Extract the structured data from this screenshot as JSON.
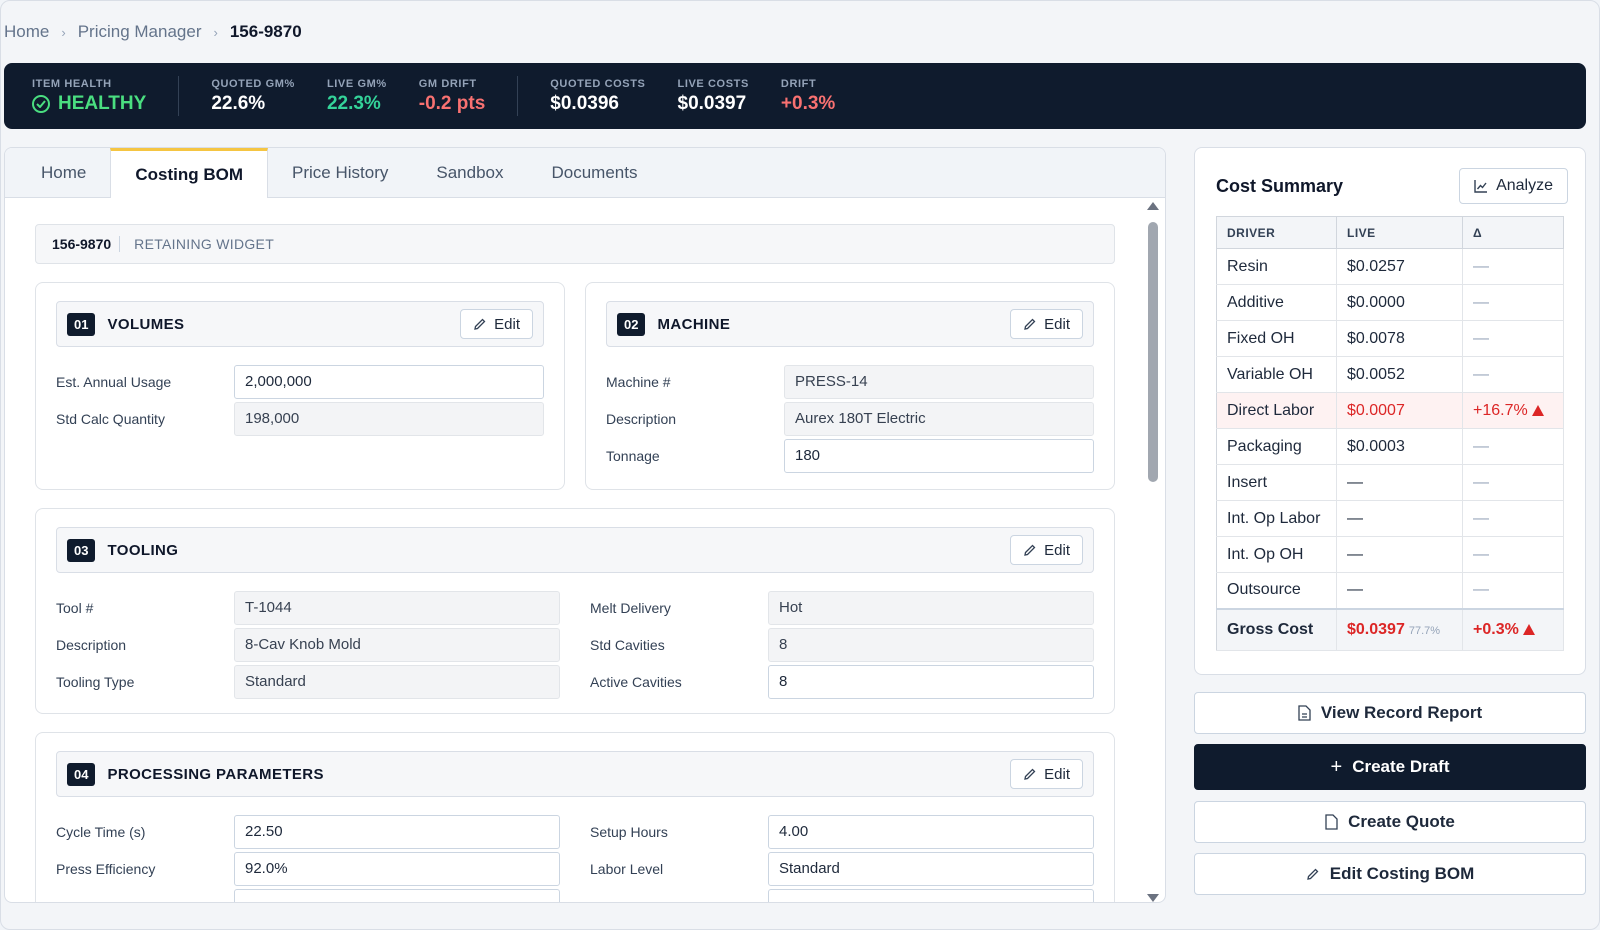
{
  "breadcrumb": {
    "home": "Home",
    "section": "Pricing Manager",
    "current": "156-9870"
  },
  "health": {
    "item_health_label": "ITEM HEALTH",
    "item_health_value": "HEALTHY",
    "quoted_gm_label": "QUOTED GM%",
    "quoted_gm_value": "22.6%",
    "live_gm_label": "LIVE GM%",
    "live_gm_value": "22.3%",
    "gm_drift_label": "GM DRIFT",
    "gm_drift_value": "-0.2 pts",
    "quoted_costs_label": "QUOTED COSTS",
    "quoted_costs_value": "$0.0396",
    "live_costs_label": "LIVE COSTS",
    "live_costs_value": "$0.0397",
    "drift_label": "DRIFT",
    "drift_value": "+0.3%"
  },
  "tabs": [
    "Home",
    "Costing BOM",
    "Price History",
    "Sandbox",
    "Documents"
  ],
  "item": {
    "number": "156-9870",
    "description": "RETAINING WIDGET"
  },
  "edit_label": "Edit",
  "volumes": {
    "num": "01",
    "title": "VOLUMES",
    "annual_usage_label": "Est. Annual Usage",
    "annual_usage_value": "2,000,000",
    "std_calc_label": "Std Calc Quantity",
    "std_calc_value": "198,000"
  },
  "machine": {
    "num": "02",
    "title": "MACHINE",
    "machine_label": "Machine #",
    "machine_value": "PRESS-14",
    "desc_label": "Description",
    "desc_value": "Aurex 180T Electric",
    "tonnage_label": "Tonnage",
    "tonnage_value": "180"
  },
  "tooling": {
    "num": "03",
    "title": "TOOLING",
    "tool_label": "Tool #",
    "tool_value": "T-1044",
    "desc_label": "Description",
    "desc_value": "8-Cav Knob Mold",
    "type_label": "Tooling Type",
    "type_value": "Standard",
    "melt_label": "Melt Delivery",
    "melt_value": "Hot",
    "std_cav_label": "Std Cavities",
    "std_cav_value": "8",
    "active_cav_label": "Active Cavities",
    "active_cav_value": "8"
  },
  "processing": {
    "num": "04",
    "title": "PROCESSING PARAMETERS",
    "cycle_label": "Cycle Time (s)",
    "cycle_value": "22.50",
    "eff_label": "Press Efficiency",
    "eff_value": "92.0%",
    "setup_label": "Setup Hours",
    "setup_value": "4.00",
    "labor_label": "Labor Level",
    "labor_value": "Standard"
  },
  "summary": {
    "title": "Cost Summary",
    "analyze_label": "Analyze",
    "headers": [
      "DRIVER",
      "LIVE",
      "Δ"
    ],
    "rows": [
      {
        "driver": "Resin",
        "live": "$0.0257",
        "delta": "—"
      },
      {
        "driver": "Additive",
        "live": "$0.0000",
        "delta": "—"
      },
      {
        "driver": "Fixed OH",
        "live": "$0.0078",
        "delta": "—"
      },
      {
        "driver": "Variable OH",
        "live": "$0.0052",
        "delta": "—"
      },
      {
        "driver": "Direct Labor",
        "live": "$0.0007",
        "delta": "+16.7%"
      },
      {
        "driver": "Packaging",
        "live": "$0.0003",
        "delta": "—"
      },
      {
        "driver": "Insert",
        "live": "—",
        "delta": "—"
      },
      {
        "driver": "Int. Op Labor",
        "live": "—",
        "delta": "—"
      },
      {
        "driver": "Int. Op OH",
        "live": "—",
        "delta": "—"
      },
      {
        "driver": "Outsource",
        "live": "—",
        "delta": "—"
      }
    ],
    "total_label": "Gross Cost",
    "total_live": "$0.0397",
    "total_pct": "77.7%",
    "total_delta": "+0.3%"
  },
  "actions": {
    "view_report": "View Record Report",
    "create_draft": "Create Draft",
    "create_quote": "Create Quote",
    "edit_bom": "Edit Costing BOM"
  }
}
